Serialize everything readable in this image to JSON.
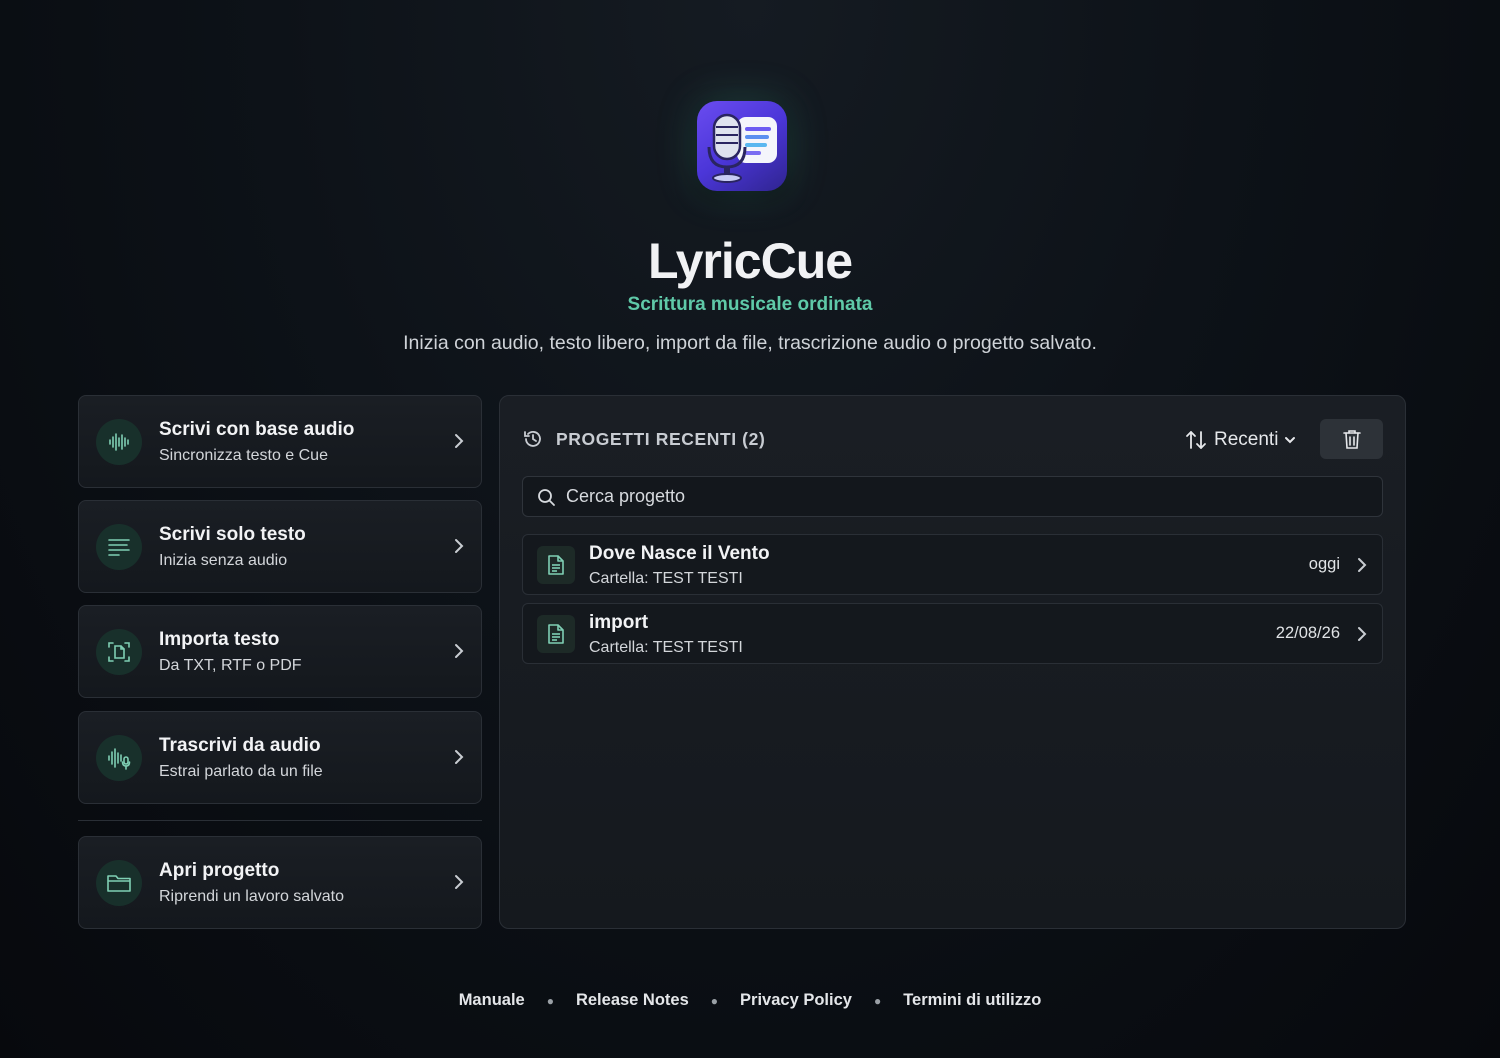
{
  "app": {
    "title": "LyricCue",
    "tagline": "Scrittura musicale ordinata",
    "subtitle": "Inizia con audio, testo libero, import da file, trascrizione audio o progetto salvato.",
    "icon": "microphone-lyrics-icon",
    "accent_color": "#5fc9a8"
  },
  "actions": [
    {
      "label": "Scrivi con base audio",
      "sub": "Sincronizza testo e Cue",
      "icon": "waveform-icon"
    },
    {
      "label": "Scrivi solo testo",
      "sub": "Inizia senza audio",
      "icon": "text-lines-icon"
    },
    {
      "label": "Importa testo",
      "sub": "Da TXT, RTF o PDF",
      "icon": "document-scan-icon"
    },
    {
      "label": "Trascrivi da audio",
      "sub": "Estrai parlato da un file",
      "icon": "waveform-mic-icon"
    }
  ],
  "open_project": {
    "label": "Apri progetto",
    "sub": "Riprendi un lavoro salvato",
    "icon": "folder-icon"
  },
  "recent": {
    "title": "PROGETTI RECENTI (2)",
    "sort_label": "Recenti",
    "search_placeholder": "Cerca progetto",
    "items": [
      {
        "name": "Dove Nasce il Vento",
        "folder": "Cartella: TEST TESTI",
        "date": "oggi"
      },
      {
        "name": "import",
        "folder": "Cartella: TEST TESTI",
        "date": "22/08/26"
      }
    ]
  },
  "footer": {
    "links": [
      "Manuale",
      "Release Notes",
      "Privacy Policy",
      "Termini di utilizzo"
    ]
  }
}
